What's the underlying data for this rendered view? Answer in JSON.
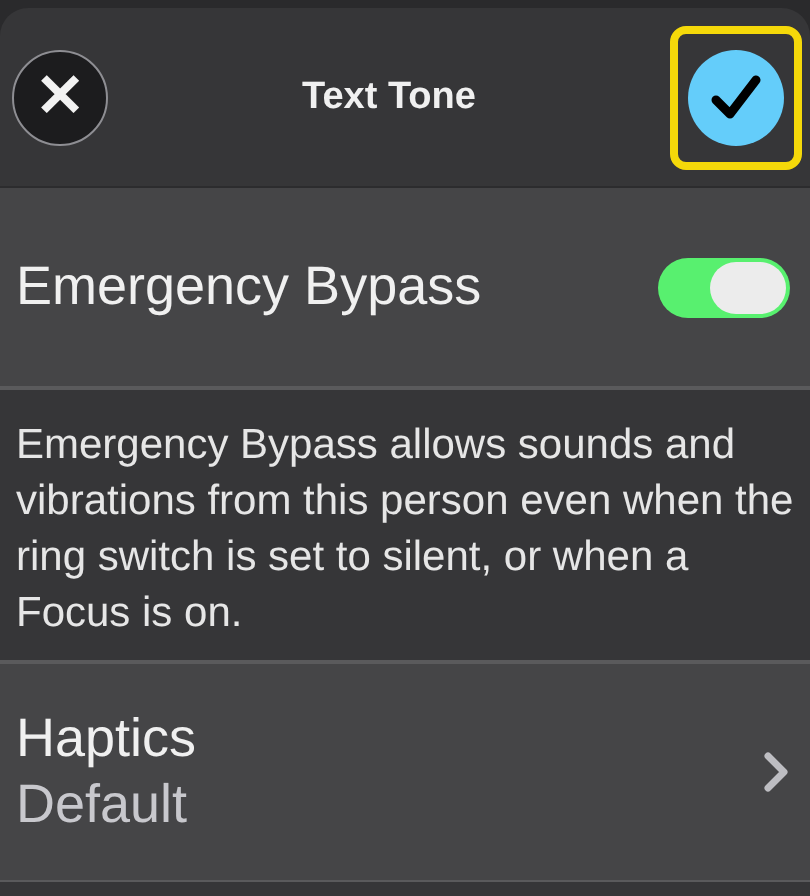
{
  "header": {
    "title": "Text Tone",
    "cancel_button": {
      "symbol": "✕"
    },
    "done_button": {
      "highlighted": true
    }
  },
  "emergency_bypass": {
    "label": "Emergency Bypass",
    "on": true
  },
  "description": "Emergency Bypass allows sounds and vibrations from this person even when the ring switch is set to silent, or when a Focus is on.",
  "haptics": {
    "label": "Haptics",
    "value": "Default"
  }
}
